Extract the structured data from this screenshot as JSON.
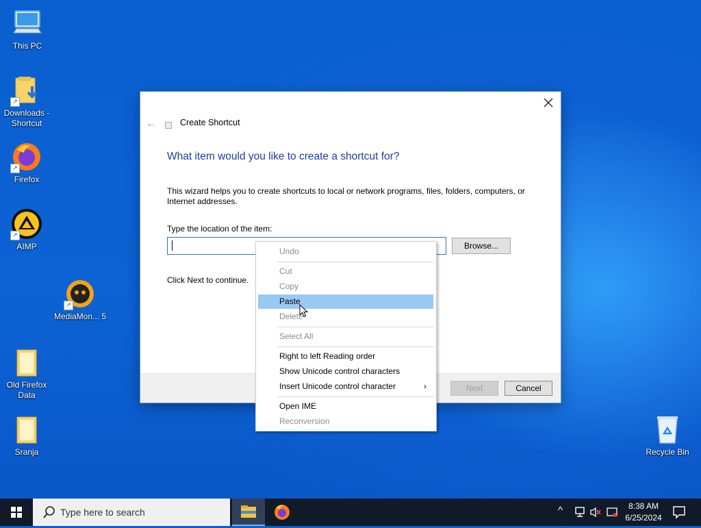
{
  "desktop": {
    "icons": [
      {
        "label": "This PC"
      },
      {
        "label": "Downloads - Shortcut"
      },
      {
        "label": "Firefox"
      },
      {
        "label": "AIMP"
      },
      {
        "label": "MediaMon... 5"
      },
      {
        "label": "Old Firefox Data"
      },
      {
        "label": "Sranja"
      },
      {
        "label": "Recycle Bin"
      }
    ]
  },
  "dialog": {
    "title": "Create Shortcut",
    "heading": "What item would you like to create a shortcut for?",
    "description": "This wizard helps you to create shortcuts to local or network programs, files, folders, computers, or Internet addresses.",
    "location_label": "Type the location of the item:",
    "location_value": "",
    "browse_label": "Browse...",
    "continue_text": "Click Next to continue.",
    "next_label": "Next",
    "cancel_label": "Cancel"
  },
  "context_menu": {
    "items": [
      {
        "label": "Undo",
        "enabled": false
      },
      {
        "label": "Cut",
        "enabled": false
      },
      {
        "label": "Copy",
        "enabled": false
      },
      {
        "label": "Paste",
        "enabled": true,
        "highlighted": true
      },
      {
        "label": "Delete",
        "enabled": false
      },
      {
        "label": "Select All",
        "enabled": false
      },
      {
        "label": "Right to left Reading order",
        "enabled": true
      },
      {
        "label": "Show Unicode control characters",
        "enabled": true
      },
      {
        "label": "Insert Unicode control character",
        "enabled": true,
        "submenu": true
      },
      {
        "label": "Open IME",
        "enabled": true
      },
      {
        "label": "Reconversion",
        "enabled": false
      }
    ],
    "submenu_arrow": "›"
  },
  "taskbar": {
    "search_placeholder": "Type here to search",
    "time": "8:38 AM",
    "date": "6/25/2024",
    "tray_chevron": "^"
  },
  "colors": {
    "accent": "#1a3e9a",
    "highlight": "#99c9f3",
    "taskbar": "#101a28"
  }
}
